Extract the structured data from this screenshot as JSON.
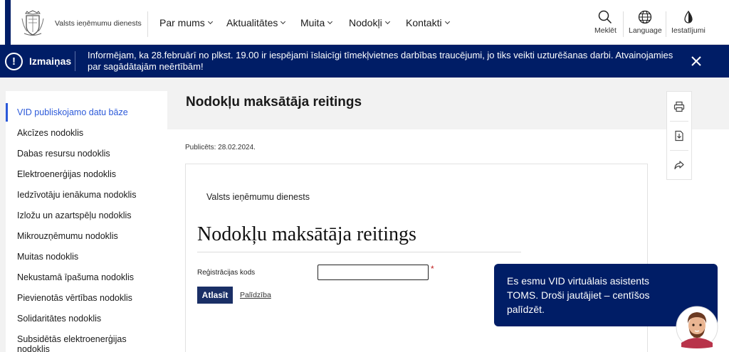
{
  "header": {
    "brand": "Valsts ieņēmumu dienests",
    "nav": [
      {
        "label": "Par mums"
      },
      {
        "label": "Aktualitātes"
      },
      {
        "label": "Muita"
      },
      {
        "label": "Nodokļi"
      },
      {
        "label": "Kontakti"
      }
    ],
    "utils": {
      "search": "Meklēt",
      "language": "Language",
      "settings": "Iestatījumi"
    }
  },
  "banner": {
    "icon": "!",
    "title": "Izmaiņas",
    "text": "Informējam, ka 28.februārī no plkst. 19.00 ir iespējami īslaicīgi tīmekļvietnes darbības traucējumi, jo tiks veikti uzturēšanas darbi. Atvainojamies par sagādātajām neērtībām!"
  },
  "sidebar": {
    "items": [
      {
        "label": "VID publiskojamo datu bāze"
      },
      {
        "label": "Akcīzes nodoklis"
      },
      {
        "label": "Dabas resursu nodoklis"
      },
      {
        "label": "Elektroenerģijas nodoklis"
      },
      {
        "label": "Iedzīvotāju ienākuma nodoklis"
      },
      {
        "label": "Izložu un azartspēļu nodoklis"
      },
      {
        "label": "Mikrouzņēmumu nodoklis"
      },
      {
        "label": "Muitas nodoklis"
      },
      {
        "label": "Nekustamā īpašuma nodoklis"
      },
      {
        "label": "Pievienotās vērtības nodoklis"
      },
      {
        "label": "Solidaritātes nodoklis"
      },
      {
        "label": "Subsidētās elektroenerģijas nodoklis"
      }
    ]
  },
  "main": {
    "title": "Nodokļu maksātāja reitings",
    "published": "Publicēts: 28.02.2024."
  },
  "form": {
    "org": "Valsts ieņēmumu dienests",
    "title": "Nodokļu maksātāja reitings",
    "label": "Reģistrācijas kods",
    "value": "",
    "required": "*",
    "submit": "Atlasīt",
    "help": "Palīdzība"
  },
  "chat": {
    "text": "Es esmu VID virtuālais asistents TOMS. Droši jautājiet – centīšos palīdzēt."
  },
  "colors": {
    "brand_navy": "#001d66",
    "active_link": "#2b59d9",
    "button": "#1a2f66"
  }
}
